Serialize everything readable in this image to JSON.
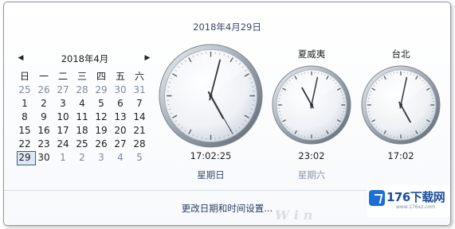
{
  "header": {
    "date": "2018年4月29日"
  },
  "calendar": {
    "month_title": "2018年4月",
    "weekdays": [
      "日",
      "一",
      "二",
      "三",
      "四",
      "五",
      "六"
    ],
    "days": [
      {
        "d": "25",
        "other": true
      },
      {
        "d": "26",
        "other": true
      },
      {
        "d": "27",
        "other": true
      },
      {
        "d": "28",
        "other": true
      },
      {
        "d": "29",
        "other": true
      },
      {
        "d": "30",
        "other": true
      },
      {
        "d": "31",
        "other": true
      },
      {
        "d": "1"
      },
      {
        "d": "2"
      },
      {
        "d": "3"
      },
      {
        "d": "4"
      },
      {
        "d": "5"
      },
      {
        "d": "6"
      },
      {
        "d": "7"
      },
      {
        "d": "8"
      },
      {
        "d": "9"
      },
      {
        "d": "10"
      },
      {
        "d": "11"
      },
      {
        "d": "12"
      },
      {
        "d": "13"
      },
      {
        "d": "14"
      },
      {
        "d": "15"
      },
      {
        "d": "16"
      },
      {
        "d": "17"
      },
      {
        "d": "18"
      },
      {
        "d": "19"
      },
      {
        "d": "20"
      },
      {
        "d": "21"
      },
      {
        "d": "22"
      },
      {
        "d": "23"
      },
      {
        "d": "24"
      },
      {
        "d": "25"
      },
      {
        "d": "26"
      },
      {
        "d": "27"
      },
      {
        "d": "28"
      },
      {
        "d": "29",
        "today": true
      },
      {
        "d": "30"
      },
      {
        "d": "1",
        "other": true
      },
      {
        "d": "2",
        "other": true
      },
      {
        "d": "3",
        "other": true
      },
      {
        "d": "4",
        "other": true
      },
      {
        "d": "5",
        "other": true
      }
    ]
  },
  "clocks": [
    {
      "label": "",
      "time": "17:02:25",
      "day": "星期日",
      "hands": {
        "hour": 17,
        "minute": 2,
        "second": 25
      }
    },
    {
      "label": "夏威夷",
      "time": "23:02",
      "day": "星期六",
      "hands": {
        "hour": 23,
        "minute": 2
      }
    },
    {
      "label": "台北",
      "time": "17:02",
      "day": "",
      "hands": {
        "hour": 17,
        "minute": 2
      }
    }
  ],
  "footer": {
    "link": "更改日期和时间设置..."
  },
  "watermark": {
    "win": "Win",
    "site": "176下载网",
    "url": "www.176xz.com"
  },
  "colors": {
    "link": "#2a3f63",
    "today_border": "#3d5c8a"
  }
}
